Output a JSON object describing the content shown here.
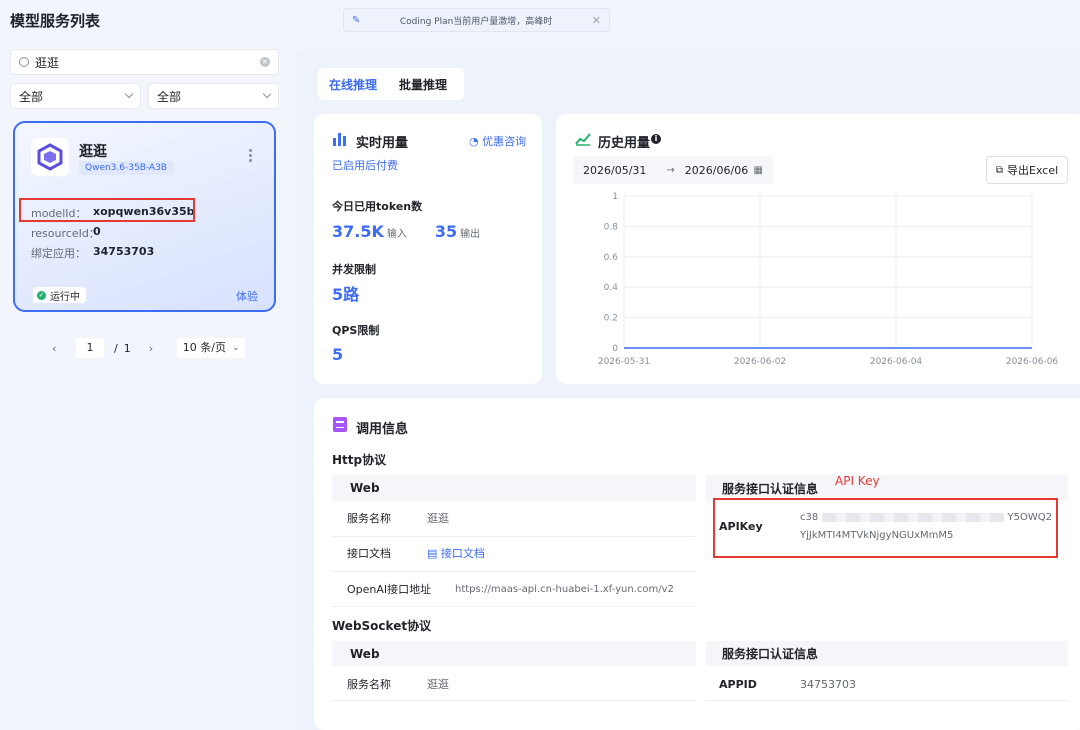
{
  "page_title": "模型服务列表",
  "toast": {
    "text": "Coding Plan当前用户量激增，高峰时"
  },
  "search": {
    "value": "逛逛"
  },
  "filters": [
    {
      "value": "全部"
    },
    {
      "value": "全部"
    }
  ],
  "model_card": {
    "name": "逛逛",
    "tag": "Qwen3.6-35B-A3B",
    "fields": [
      {
        "key": "modelId：",
        "value": "xopqwen36v35b"
      },
      {
        "key": "resourceId：",
        "value": "0"
      },
      {
        "key": "绑定应用：",
        "value": "34753703"
      }
    ],
    "status": "运行中",
    "action": "体验"
  },
  "pager": {
    "current": "1",
    "separator": "/",
    "total": "1",
    "page_size": "10 条/页"
  },
  "tabs": [
    {
      "label": "在线推理"
    },
    {
      "label": "批量推理"
    }
  ],
  "realtime": {
    "title": "实时用量",
    "consult": "优惠咨询",
    "billing": "已启用后付费",
    "token_label": "今日已用token数",
    "input_value": "37.5K",
    "input_unit": "输入",
    "output_value": "35",
    "output_unit": "输出",
    "concurrency_label": "并发限制",
    "concurrency_value": "5路",
    "qps_label": "QPS限制",
    "qps_value": "5"
  },
  "history": {
    "title": "历史用量",
    "date_start": "2026/05/31",
    "date_end": "2026/06/06",
    "date_sep": "→",
    "export": "导出Excel"
  },
  "chart_data": {
    "type": "line",
    "x": [
      "2026-05-31",
      "2026-06-01",
      "2026-06-02",
      "2026-06-03",
      "2026-06-04",
      "2026-06-05",
      "2026-06-06"
    ],
    "x_tick_labels": [
      "2026-05-31",
      "2026-06-02",
      "2026-06-04",
      "2026-06-06"
    ],
    "y_tick_labels": [
      "1",
      "0.8",
      "0.6",
      "0.4",
      "0.2",
      "0"
    ],
    "series": [
      {
        "values": [
          0,
          0,
          0,
          0,
          0,
          0,
          0
        ]
      }
    ],
    "ylim": [
      0,
      1
    ],
    "grid": true,
    "line_color": "#3d6cf5"
  },
  "invoke": {
    "title": "调用信息",
    "http_title": "Http协议",
    "ws_title": "WebSocket协议",
    "web_head": "Web",
    "auth_head": "服务接口认证信息",
    "annotation": "API Key",
    "http_rows": [
      {
        "key": "服务名称",
        "value": "逛逛"
      },
      {
        "key": "接口文档",
        "value": "接口文档"
      },
      {
        "key": "OpenAI接口地址",
        "value": "https://maas-api.cn-huabei-1.xf-yun.com/v2"
      }
    ],
    "apikey_label": "APIKey",
    "apikey_line1_start": "c38",
    "apikey_line1_end": "Y5OWQ2",
    "apikey_line2": "YjJkMTI4MTVkNjgyNGUxMmM5",
    "ws_rows": [
      {
        "key": "服务名称",
        "value": "逛逛"
      }
    ],
    "appid_label": "APPID",
    "appid_value": "34753703"
  }
}
